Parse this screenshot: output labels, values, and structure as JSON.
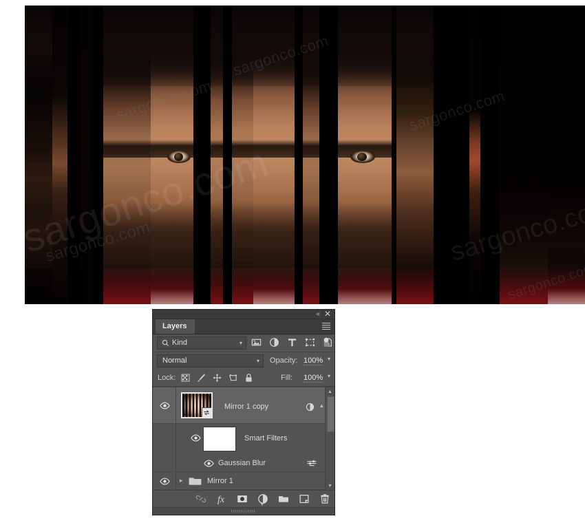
{
  "app": {
    "watermark_text": "sargonco.com"
  },
  "photo": {
    "alt": "portrait-with-vertical-mirror-stripes",
    "background_color": "#030101",
    "bar_color": "#000000",
    "watermarks": [
      "sargonco.com",
      "sargonco.com",
      "sargonco.com",
      "sargonco.com",
      "sargonco.com",
      "sargonco.com",
      "sargonco.com"
    ]
  },
  "panel": {
    "title": "Layers",
    "collapse_icon": "double-chevron-left-icon",
    "close_icon": "close-icon",
    "menu_icon": "panel-menu-icon"
  },
  "filter": {
    "search_icon": "search-icon",
    "kind_label": "Kind",
    "caret": "chevron-down-icon",
    "icons": [
      {
        "name": "filter-pixel-icon",
        "title": "Pixel layers"
      },
      {
        "name": "filter-adjustment-icon",
        "title": "Adjustment layers"
      },
      {
        "name": "filter-type-icon",
        "title": "Type layers"
      },
      {
        "name": "filter-shape-icon",
        "title": "Shape layers"
      },
      {
        "name": "filter-smart-object-icon",
        "title": "Smart objects"
      }
    ],
    "toggle_icon": "filter-toggle-icon"
  },
  "blend": {
    "mode": "Normal",
    "caret": "chevron-down-icon",
    "opacity_label": "Opacity:",
    "opacity_value": "100%",
    "opacity_caret": "chevron-down-icon"
  },
  "lock": {
    "label": "Lock:",
    "icons": [
      {
        "name": "lock-transparency-icon",
        "title": "Lock transparent pixels"
      },
      {
        "name": "lock-paint-icon",
        "title": "Lock image pixels"
      },
      {
        "name": "lock-position-icon",
        "title": "Lock position"
      },
      {
        "name": "lock-artboard-icon",
        "title": "Prevent auto-nesting"
      },
      {
        "name": "lock-all-icon",
        "title": "Lock all"
      }
    ],
    "fill_label": "Fill:",
    "fill_value": "100%",
    "fill_caret": "chevron-down-icon"
  },
  "layers": [
    {
      "id": "mirror-1-copy",
      "name": "Mirror 1 copy",
      "type": "smart-object",
      "visible": true,
      "selected": true,
      "visibility_icon": "eye-icon",
      "fx_icon": "smart-filter-icon",
      "expand_icon": "chevron-up-icon",
      "badge": "smart-object-badge"
    },
    {
      "id": "smart-filters",
      "name": "Smart Filters",
      "type": "smart-filter-group",
      "visible": true,
      "selected": false,
      "visibility_icon": "eye-icon",
      "mask": "white-filter-mask"
    },
    {
      "id": "gaussian-blur",
      "name": "Gaussian Blur",
      "type": "smart-filter",
      "visible": true,
      "selected": false,
      "visibility_icon": "eye-icon",
      "settings_icon": "filter-options-icon"
    },
    {
      "id": "mirror-1",
      "name": "Mirror 1",
      "type": "group",
      "visible": true,
      "selected": false,
      "visibility_icon": "eye-icon",
      "expand_icon": "chevron-right-icon",
      "folder_icon": "folder-icon"
    }
  ],
  "scrollbar": {
    "up_icon": "chevron-up-icon",
    "down_icon": "chevron-down-icon"
  },
  "bottom_toolbar": [
    {
      "name": "link-layers-button",
      "icon": "link-icon",
      "label": ""
    },
    {
      "name": "layer-style-button",
      "icon": "fx-icon",
      "label": "fx"
    },
    {
      "name": "add-layer-mask-button",
      "icon": "mask-icon",
      "label": ""
    },
    {
      "name": "new-adjustment-layer-button",
      "icon": "adjustment-icon",
      "label": ""
    },
    {
      "name": "new-group-button",
      "icon": "folder-icon",
      "label": ""
    },
    {
      "name": "new-layer-button",
      "icon": "new-layer-icon",
      "label": ""
    },
    {
      "name": "delete-layer-button",
      "icon": "trash-icon",
      "label": ""
    }
  ]
}
